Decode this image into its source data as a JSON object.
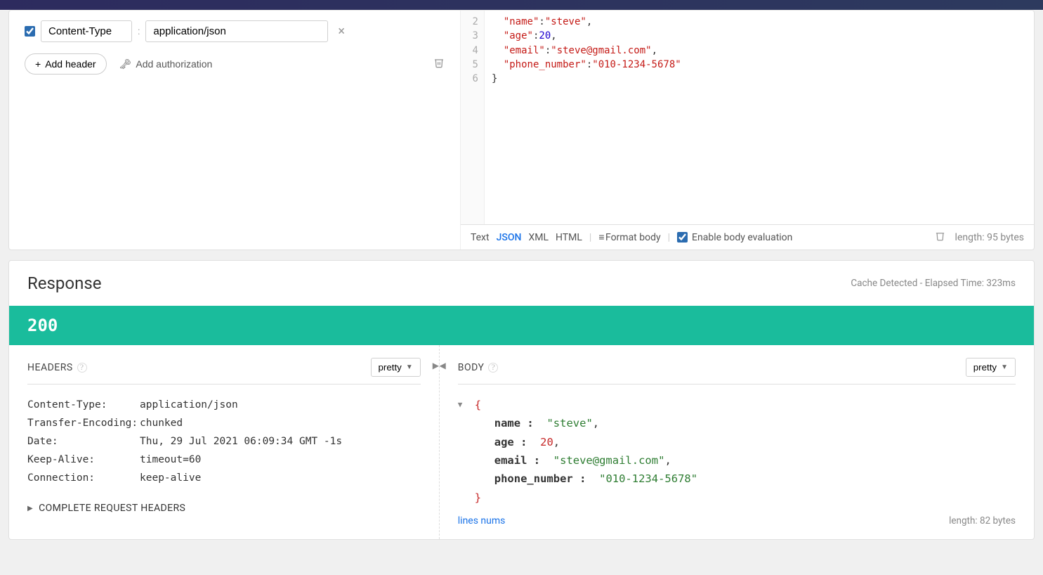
{
  "request": {
    "headers": [
      {
        "enabled": true,
        "key": "Content-Type",
        "value": "application/json"
      }
    ],
    "add_header_label": "Add header",
    "add_auth_label": "Add authorization",
    "body_lines": [
      2,
      3,
      4,
      5,
      6
    ],
    "body_json": {
      "name": "steve",
      "age": 20,
      "email": "steve@gmail.com",
      "phone_number": "010-1234-5678"
    },
    "body_toolbar": {
      "text": "Text",
      "json": "JSON",
      "xml": "XML",
      "html": "HTML",
      "format": "Format body",
      "enable_eval": "Enable body evaluation",
      "length": "length: 95 bytes"
    }
  },
  "response": {
    "title": "Response",
    "meta": "Cache Detected - Elapsed Time: 323ms",
    "status": "200",
    "headers_title": "HEADERS",
    "body_title": "BODY",
    "pretty_label": "pretty",
    "headers": [
      {
        "k": "Content-Type:",
        "v": "application/json"
      },
      {
        "k": "Transfer-Encoding:",
        "v": "chunked"
      },
      {
        "k": "Date:",
        "v": "Thu, 29 Jul 2021 06:09:34 GMT",
        "ago": "-1s"
      },
      {
        "k": "Keep-Alive:",
        "v": "timeout=60"
      },
      {
        "k": "Connection:",
        "v": "keep-alive"
      }
    ],
    "complete_headers_label": "COMPLETE REQUEST HEADERS",
    "body_json": {
      "name": "steve",
      "age": 20,
      "email": "steve@gmail.com",
      "phone_number": "010-1234-5678"
    },
    "lines_nums_label": "lines nums",
    "body_length": "length: 82 bytes"
  }
}
